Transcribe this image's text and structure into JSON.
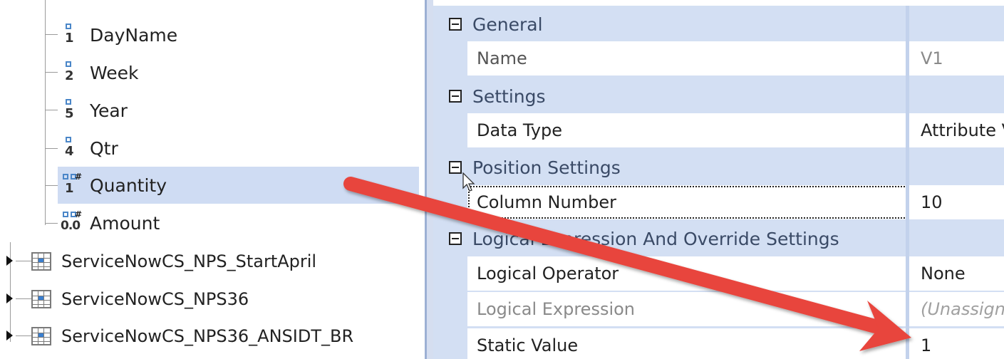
{
  "tree": {
    "fields": [
      {
        "label": "DayName",
        "icon": "numeric-field-icon",
        "digit": "1"
      },
      {
        "label": "Week",
        "icon": "numeric-field-icon",
        "digit": "2"
      },
      {
        "label": "Year",
        "icon": "numeric-field-icon",
        "digit": "5"
      },
      {
        "label": "Qtr",
        "icon": "numeric-field-icon",
        "digit": "4"
      },
      {
        "label": "Quantity",
        "icon": "integer-measure-icon",
        "digit": "1",
        "selected": true
      },
      {
        "label": "Amount",
        "icon": "decimal-measure-icon",
        "digit": "0.0"
      }
    ],
    "tables": [
      {
        "label": "ServiceNowCS_NPS_StartApril",
        "icon": "table-icon"
      },
      {
        "label": "ServiceNowCS_NPS36",
        "icon": "table-icon"
      },
      {
        "label": "ServiceNowCS_NPS36_ANSIDT_BR",
        "icon": "table-icon"
      }
    ]
  },
  "properties": {
    "categories": [
      {
        "title": "General",
        "rows": [
          {
            "name": "Name",
            "value": "V1",
            "muted": true
          }
        ]
      },
      {
        "title": "Settings",
        "rows": [
          {
            "name": "Data Type",
            "value": "Attribute V"
          }
        ]
      },
      {
        "title": "Position Settings",
        "rows": [
          {
            "name": "Column Number",
            "value": "10",
            "focused": true
          }
        ]
      },
      {
        "title": "Logical Expression And Override Settings",
        "rows": [
          {
            "name": "Logical Operator",
            "value": "None"
          },
          {
            "name": "Logical Expression",
            "value": "(Unassign",
            "muted": true
          },
          {
            "name": "Static Value",
            "value": "1"
          }
        ]
      }
    ]
  },
  "colors": {
    "arrow": "#e8453c",
    "selection": "#cfdcf3",
    "category_bg": "#d3dff3",
    "icon_blue": "#4a86c8"
  }
}
